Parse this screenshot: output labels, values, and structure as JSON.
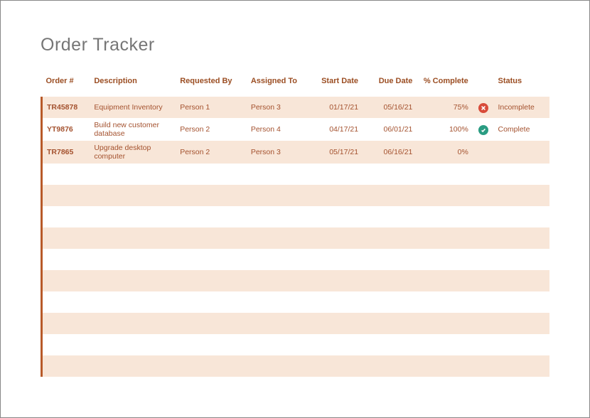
{
  "title": "Order Tracker",
  "columns": {
    "order": "Order #",
    "description": "Description",
    "requested_by": "Requested By",
    "assigned_to": "Assigned To",
    "start_date": "Start Date",
    "due_date": "Due Date",
    "pct_complete": "% Complete",
    "status": "Status"
  },
  "rows": [
    {
      "order": "TR45878",
      "description": "Equipment Inventory",
      "requested_by": "Person 1",
      "assigned_to": "Person 3",
      "start_date": "01/17/21",
      "due_date": "05/16/21",
      "pct_complete": "75%",
      "status_icon": "incomplete",
      "status": "Incomplete"
    },
    {
      "order": "YT9876",
      "description": "Build new customer database",
      "requested_by": "Person 2",
      "assigned_to": "Person 4",
      "start_date": "04/17/21",
      "due_date": "06/01/21",
      "pct_complete": "100%",
      "status_icon": "complete",
      "status": "Complete"
    },
    {
      "order": "TR7865",
      "description": "Upgrade desktop computer",
      "requested_by": "Person 2",
      "assigned_to": "Person 3",
      "start_date": "05/17/21",
      "due_date": "06/16/21",
      "pct_complete": "0%",
      "status_icon": "",
      "status": ""
    }
  ],
  "empty_rows": 10
}
